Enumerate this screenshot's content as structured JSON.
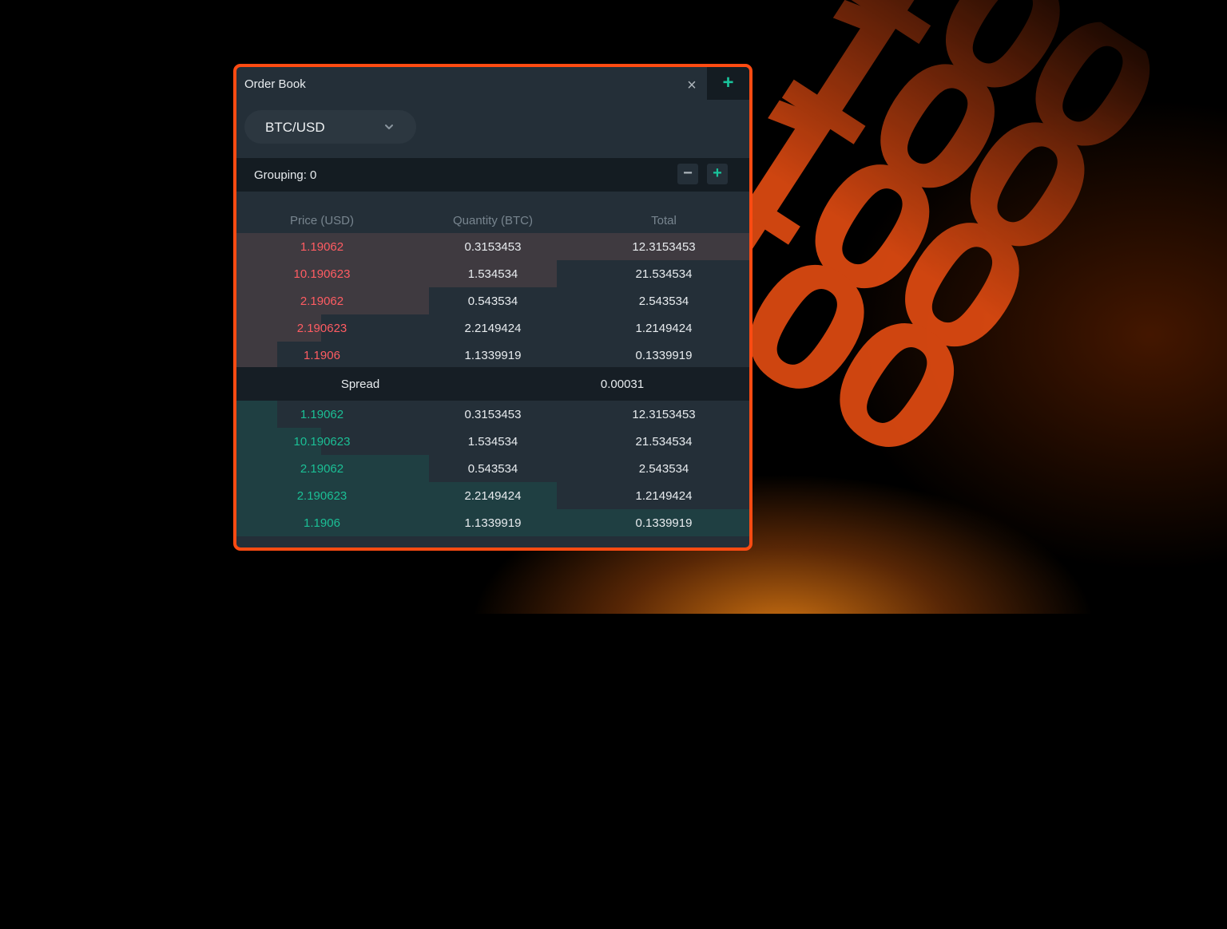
{
  "colors": {
    "accent_border": "#ff4b12",
    "ask_price": "#ff5c62",
    "bid_price": "#1bbf95",
    "panel_bg": "#242f38"
  },
  "panel": {
    "title": "Order Book",
    "close_icon": "×",
    "add_icon": "+"
  },
  "pair_selector": {
    "value": "BTC/USD"
  },
  "grouping": {
    "label": "Grouping: 0",
    "minus": "−",
    "plus": "+"
  },
  "columns": [
    "Price (USD)",
    "Quantity (BTC)",
    "Total"
  ],
  "asks": [
    {
      "price": "1.19062",
      "quantity": "0.3153453",
      "total": "12.3153453",
      "depth": 1.0
    },
    {
      "price": "10.190623",
      "quantity": "1.534534",
      "total": "21.534534",
      "depth": 0.625
    },
    {
      "price": "2.19062",
      "quantity": "0.543534",
      "total": "2.543534",
      "depth": 0.375
    },
    {
      "price": "2.190623",
      "quantity": "2.2149424",
      "total": "1.2149424",
      "depth": 0.165
    },
    {
      "price": "1.1906",
      "quantity": "1.1339919",
      "total": "0.1339919",
      "depth": 0.08
    }
  ],
  "spread": {
    "label": "Spread",
    "value": "0.00031"
  },
  "bids": [
    {
      "price": "1.19062",
      "quantity": "0.3153453",
      "total": "12.3153453",
      "depth": 0.08
    },
    {
      "price": "10.190623",
      "quantity": "1.534534",
      "total": "21.534534",
      "depth": 0.165
    },
    {
      "price": "2.19062",
      "quantity": "0.543534",
      "total": "2.543534",
      "depth": 0.375
    },
    {
      "price": "2.190623",
      "quantity": "2.2149424",
      "total": "1.2149424",
      "depth": 0.625
    },
    {
      "price": "1.1906",
      "quantity": "1.1339919",
      "total": "0.1339919",
      "depth": 1.0
    }
  ],
  "decoration": {
    "lines": [
      "100",
      "100",
      "100",
      "100"
    ]
  }
}
